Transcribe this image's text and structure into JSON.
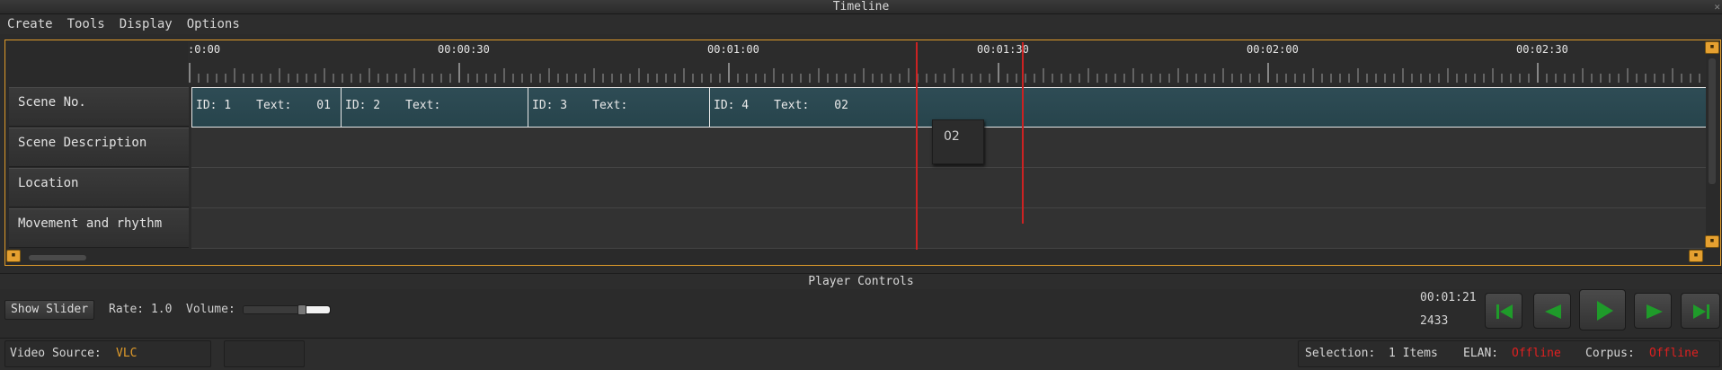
{
  "window": {
    "title": "Timeline"
  },
  "menu": [
    "Create",
    "Tools",
    "Display",
    "Options"
  ],
  "ruler": {
    "labels": [
      ":0:00",
      "00:00:30",
      "00:01:00",
      "00:01:30",
      "00:02:00",
      "00:02:30"
    ]
  },
  "tracks": [
    {
      "label": "Scene No."
    },
    {
      "label": "Scene Description"
    },
    {
      "label": "Location"
    },
    {
      "label": "Movement and rhythm"
    }
  ],
  "segments": [
    {
      "id_label": "ID: 1",
      "text_label": "Text:",
      "value": "01"
    },
    {
      "id_label": "ID: 2",
      "text_label": "Text:",
      "value": ""
    },
    {
      "id_label": "ID: 3",
      "text_label": "Text:",
      "value": ""
    },
    {
      "id_label": "ID: 4",
      "text_label": "Text:",
      "value": "02"
    }
  ],
  "tooltip": {
    "text": "02"
  },
  "player": {
    "title": "Player Controls",
    "show_slider": "Show Slider",
    "rate": "Rate: 1.0",
    "volume_label": "Volume:",
    "volume_level": 0.68,
    "timecode": "00:01:21",
    "frame": "2433",
    "buttons": [
      "skip-to-start-icon",
      "rewind-icon",
      "play-icon",
      "fast-forward-icon",
      "skip-to-end-icon"
    ],
    "button_color": "#1f9b2a"
  },
  "status": {
    "video_source_label": "Video Source:",
    "video_source_value": "VLC",
    "selection_label": "Selection:",
    "selection_value": "1 Items",
    "elan_label": "ELAN:",
    "elan_value": "Offline",
    "corpus_label": "Corpus:",
    "corpus_value": "Offline"
  },
  "colors": {
    "accent": "#e09b2a",
    "playhead": "#cc2222",
    "segment": "#2e4c55",
    "offline": "#e02020"
  }
}
